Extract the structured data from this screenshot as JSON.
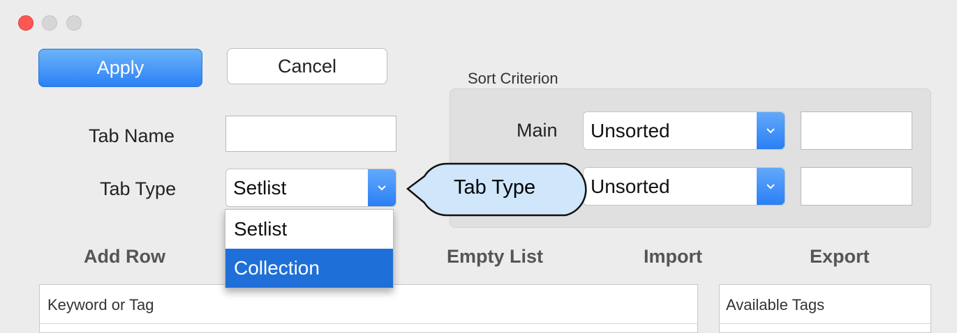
{
  "window": {
    "controls": [
      "close",
      "minimize",
      "zoom"
    ]
  },
  "toolbar": {
    "apply_label": "Apply",
    "cancel_label": "Cancel"
  },
  "form": {
    "tab_name_label": "Tab Name",
    "tab_name_value": "",
    "tab_type_label": "Tab Type",
    "tab_type_value": "Setlist"
  },
  "sort": {
    "title": "Sort Criterion",
    "main_label": "Main",
    "main_value": "Unsorted",
    "secondary_value": "Unsorted"
  },
  "dropdown": {
    "options": [
      "Setlist",
      "Collection"
    ],
    "highlighted": "Collection"
  },
  "callout": {
    "text": "Tab Type"
  },
  "actions": {
    "add_row": "Add Row",
    "empty_list": "Empty List",
    "import": "Import",
    "export": "Export"
  },
  "table": {
    "keyword_header": "Keyword or Tag",
    "tags_header": "Available Tags"
  },
  "colors": {
    "accent": "#2a7ff5",
    "close": "#fc5753",
    "inactive": "#d0d0d0",
    "highlight": "#1f6fd8",
    "callout_fill": "#cfe6fb"
  }
}
